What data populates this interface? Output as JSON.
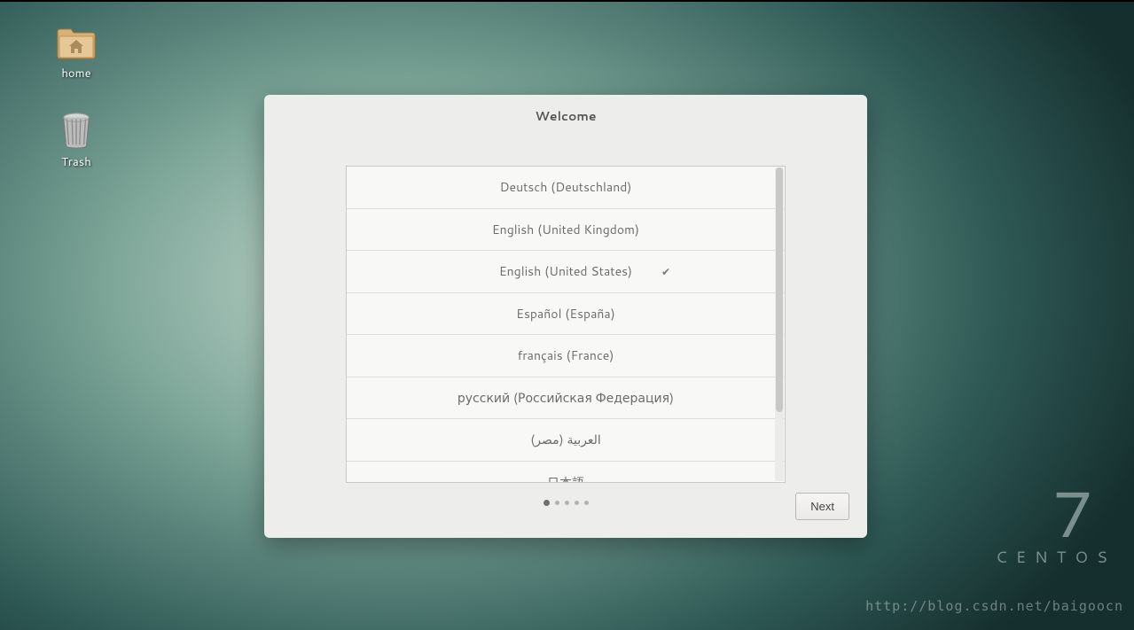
{
  "desktop": {
    "icons": [
      {
        "label": "home"
      },
      {
        "label": "Trash"
      }
    ]
  },
  "branding": {
    "version": "7",
    "name": "CENTOS"
  },
  "watermark": "http://blog.csdn.net/baigoocn",
  "dialog": {
    "title": "Welcome",
    "next_label": "Next",
    "languages": [
      {
        "label": "Deutsch (Deutschland)",
        "selected": false
      },
      {
        "label": "English (United Kingdom)",
        "selected": false
      },
      {
        "label": "English (United States)",
        "selected": true
      },
      {
        "label": "Español (España)",
        "selected": false
      },
      {
        "label": "français (France)",
        "selected": false
      },
      {
        "label": "русский (Российская Федерация)",
        "selected": false
      },
      {
        "label": "العربية (مصر)",
        "selected": false
      },
      {
        "label": "日本語",
        "selected": false
      }
    ],
    "pager": {
      "total": 5,
      "current": 0
    }
  }
}
